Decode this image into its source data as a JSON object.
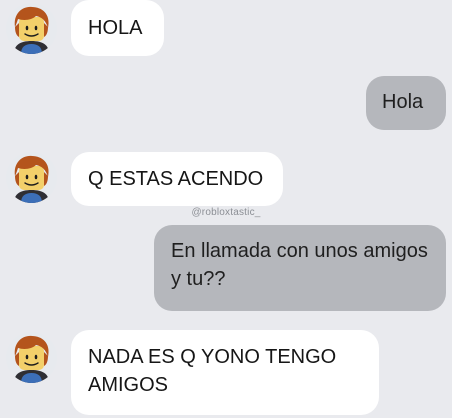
{
  "conversation": {
    "messages": [
      {
        "sender": "contact",
        "text": "HOLA"
      },
      {
        "sender": "me",
        "text": "Hola"
      },
      {
        "sender": "contact",
        "text": "Q ESTAS ACENDO"
      },
      {
        "sender": "me",
        "text": "En llamada con unos amigos y tu??"
      },
      {
        "sender": "contact",
        "text": "NADA ES Q YONO TENGO AMIGOS"
      }
    ],
    "watermark": "@robloxtastic_"
  },
  "contact": {
    "avatar_icon": "roblox-avatar-icon"
  },
  "colors": {
    "background": "#e9eaee",
    "incoming_bubble": "#ffffff",
    "outgoing_bubble": "#b5b7bc",
    "avatar_hair": "#b4541c",
    "avatar_skin": "#f3d06a",
    "avatar_shirt": "#3c6fb8"
  }
}
